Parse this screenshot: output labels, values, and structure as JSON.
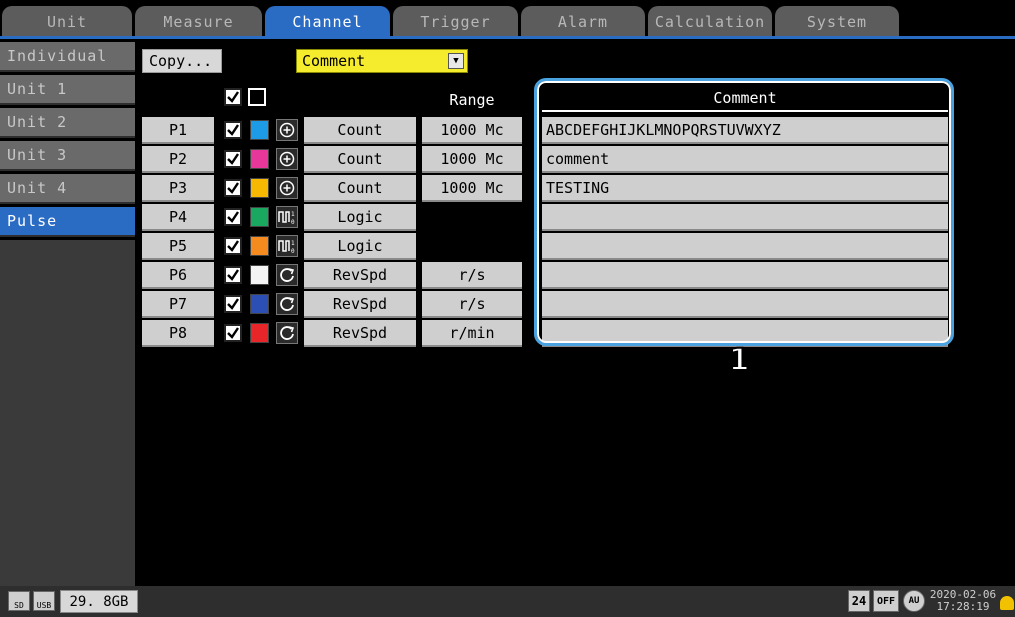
{
  "tabs": [
    {
      "label": "Unit"
    },
    {
      "label": "Measure"
    },
    {
      "label": "Channel"
    },
    {
      "label": "Trigger"
    },
    {
      "label": "Alarm"
    },
    {
      "label": "Calculation"
    },
    {
      "label": "System"
    }
  ],
  "active_tab": "Channel",
  "sidebar": {
    "items": [
      {
        "label": "Individual"
      },
      {
        "label": "Unit 1"
      },
      {
        "label": "Unit 2"
      },
      {
        "label": "Unit 3"
      },
      {
        "label": "Unit 4"
      },
      {
        "label": "Pulse"
      }
    ],
    "active": "Pulse"
  },
  "toolbar": {
    "copy_label": "Copy...",
    "view_select": "Comment"
  },
  "table": {
    "headers": {
      "range": "Range",
      "comment": "Comment"
    },
    "rows": [
      {
        "ch": "P1",
        "color": "#1e9be6",
        "icon": "count-icon",
        "mode": "Count",
        "range": "1000 Mc",
        "comment": "ABCDEFGHIJKLMNOPQRSTUVWXYZ"
      },
      {
        "ch": "P2",
        "color": "#e8379a",
        "icon": "count-icon",
        "mode": "Count",
        "range": "1000 Mc",
        "comment": "comment"
      },
      {
        "ch": "P3",
        "color": "#f6b800",
        "icon": "count-icon",
        "mode": "Count",
        "range": "1000 Mc",
        "comment": "TESTING"
      },
      {
        "ch": "P4",
        "color": "#1aa860",
        "icon": "logic-icon",
        "mode": "Logic",
        "range": "",
        "comment": ""
      },
      {
        "ch": "P5",
        "color": "#f58a1e",
        "icon": "logic-icon",
        "mode": "Logic",
        "range": "",
        "comment": ""
      },
      {
        "ch": "P6",
        "color": "#f4f4f4",
        "icon": "rotation-icon",
        "mode": "RevSpd",
        "range": "r/s",
        "comment": ""
      },
      {
        "ch": "P7",
        "color": "#2b4fb4",
        "icon": "rotation-icon",
        "mode": "RevSpd",
        "range": "r/s",
        "comment": ""
      },
      {
        "ch": "P8",
        "color": "#e8262a",
        "icon": "rotation-icon",
        "mode": "RevSpd",
        "range": "r/min",
        "comment": ""
      }
    ]
  },
  "callout_number": "1",
  "status": {
    "free_space": "29. 8GB",
    "sd_label": "SD",
    "usb_label": "USB",
    "display_time_label": "24",
    "off_label": "OFF",
    "auto_label": "AU",
    "date": "2020-02-06",
    "time": "17:28:19"
  },
  "colors": {
    "accent": "#2a6bc4",
    "highlight_frame": "#4aa3e0",
    "selector_yellow": "#f5ec2e"
  }
}
